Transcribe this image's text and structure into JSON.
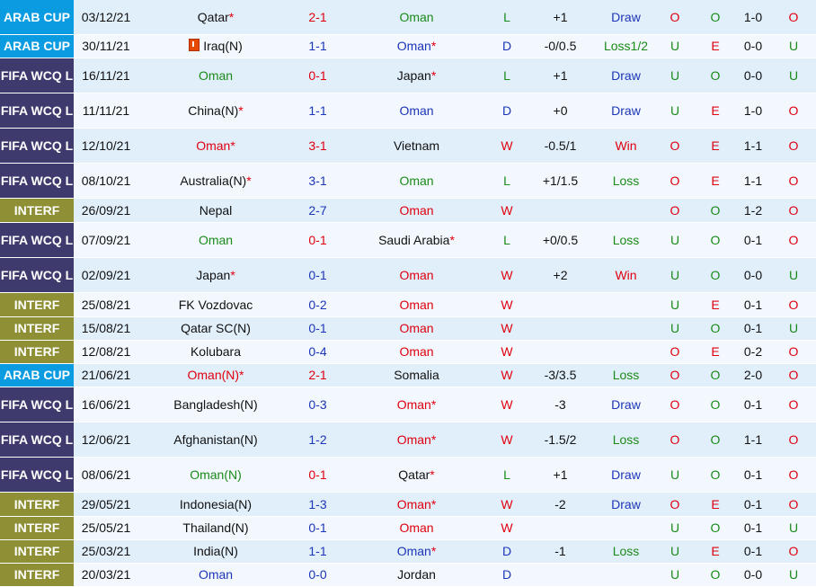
{
  "colors": {
    "arab_cup": "#0a9be0",
    "fifa_wcq": "#3f3a6e",
    "interf": "#8f9036",
    "red": "#e0000f",
    "green": "#1a8a1a",
    "blue": "#1d35b8"
  },
  "matches": [
    {
      "league": "ARAB CUP",
      "ltype": "arab",
      "date": "03/12/21",
      "home": "Qatar",
      "home_star": "*",
      "home_color": "dark",
      "score": "2-1",
      "score_color": "red",
      "away": "Oman",
      "away_star": "",
      "away_color": "green",
      "res": "L",
      "res_color": "green",
      "hcap": "+1",
      "hres": "Draw",
      "hres_color": "blue",
      "ou1": "O",
      "ou1_color": "red",
      "ou2": "O",
      "ou2_color": "green",
      "ht": "1-0",
      "last": "O",
      "last_color": "red",
      "h": 38
    },
    {
      "league": "ARAB CUP",
      "ltype": "arab",
      "date": "30/11/21",
      "home": "Iraq(N)",
      "home_star": "",
      "home_color": "dark",
      "home_flag": true,
      "score": "1-1",
      "score_color": "blue",
      "away": "Oman",
      "away_star": "*",
      "away_color": "blue",
      "res": "D",
      "res_color": "blue",
      "hcap": "-0/0.5",
      "hres": "Loss1/2",
      "hres_color": "green",
      "ou1": "U",
      "ou1_color": "green",
      "ou2": "E",
      "ou2_color": "red",
      "ht": "0-0",
      "last": "U",
      "last_color": "green",
      "h": 26
    },
    {
      "league": "FIFA WCQ L",
      "ltype": "fifa",
      "date": "16/11/21",
      "home": "Oman",
      "home_star": "",
      "home_color": "green",
      "score": "0-1",
      "score_color": "red",
      "away": "Japan",
      "away_star": "*",
      "away_color": "dark",
      "res": "L",
      "res_color": "green",
      "hcap": "+1",
      "hres": "Draw",
      "hres_color": "blue",
      "ou1": "U",
      "ou1_color": "green",
      "ou2": "O",
      "ou2_color": "green",
      "ht": "0-0",
      "last": "U",
      "last_color": "green",
      "h": 39
    },
    {
      "league": "FIFA WCQ L",
      "ltype": "fifa",
      "date": "11/11/21",
      "home": "China(N)",
      "home_star": "*",
      "home_color": "dark",
      "score": "1-1",
      "score_color": "blue",
      "away": "Oman",
      "away_star": "",
      "away_color": "blue",
      "res": "D",
      "res_color": "blue",
      "hcap": "+0",
      "hres": "Draw",
      "hres_color": "blue",
      "ou1": "U",
      "ou1_color": "green",
      "ou2": "E",
      "ou2_color": "red",
      "ht": "1-0",
      "last": "O",
      "last_color": "red",
      "h": 39
    },
    {
      "league": "FIFA WCQ L",
      "ltype": "fifa",
      "date": "12/10/21",
      "home": "Oman",
      "home_star": "*",
      "home_color": "red",
      "score": "3-1",
      "score_color": "red",
      "away": "Vietnam",
      "away_star": "",
      "away_color": "dark",
      "res": "W",
      "res_color": "red",
      "hcap": "-0.5/1",
      "hres": "Win",
      "hres_color": "red",
      "ou1": "O",
      "ou1_color": "red",
      "ou2": "E",
      "ou2_color": "red",
      "ht": "1-1",
      "last": "O",
      "last_color": "red",
      "h": 39
    },
    {
      "league": "FIFA WCQ L",
      "ltype": "fifa",
      "date": "08/10/21",
      "home": "Australia(N)",
      "home_star": "*",
      "home_color": "dark",
      "score": "3-1",
      "score_color": "blue",
      "away": "Oman",
      "away_star": "",
      "away_color": "green",
      "res": "L",
      "res_color": "green",
      "hcap": "+1/1.5",
      "hres": "Loss",
      "hres_color": "green",
      "ou1": "O",
      "ou1_color": "red",
      "ou2": "E",
      "ou2_color": "red",
      "ht": "1-1",
      "last": "O",
      "last_color": "red",
      "h": 39
    },
    {
      "league": "INTERF",
      "ltype": "interf",
      "date": "26/09/21",
      "home": "Nepal",
      "home_star": "",
      "home_color": "dark",
      "score": "2-7",
      "score_color": "blue",
      "away": "Oman",
      "away_star": "",
      "away_color": "red",
      "res": "W",
      "res_color": "red",
      "hcap": "",
      "hres": "",
      "hres_color": "dark",
      "ou1": "O",
      "ou1_color": "red",
      "ou2": "O",
      "ou2_color": "green",
      "ht": "1-2",
      "last": "O",
      "last_color": "red",
      "h": 27
    },
    {
      "league": "FIFA WCQ L",
      "ltype": "fifa",
      "date": "07/09/21",
      "home": "Oman",
      "home_star": "",
      "home_color": "green",
      "score": "0-1",
      "score_color": "red",
      "away": "Saudi Arabia",
      "away_star": "*",
      "away_color": "dark",
      "res": "L",
      "res_color": "green",
      "hcap": "+0/0.5",
      "hres": "Loss",
      "hres_color": "green",
      "ou1": "U",
      "ou1_color": "green",
      "ou2": "O",
      "ou2_color": "green",
      "ht": "0-1",
      "last": "O",
      "last_color": "red",
      "h": 39
    },
    {
      "league": "FIFA WCQ L",
      "ltype": "fifa",
      "date": "02/09/21",
      "home": "Japan",
      "home_star": "*",
      "home_color": "dark",
      "score": "0-1",
      "score_color": "blue",
      "away": "Oman",
      "away_star": "",
      "away_color": "red",
      "res": "W",
      "res_color": "red",
      "hcap": "+2",
      "hres": "Win",
      "hres_color": "red",
      "ou1": "U",
      "ou1_color": "green",
      "ou2": "O",
      "ou2_color": "green",
      "ht": "0-0",
      "last": "U",
      "last_color": "green",
      "h": 39
    },
    {
      "league": "INTERF",
      "ltype": "interf",
      "date": "25/08/21",
      "home": "FK Vozdovac",
      "home_star": "",
      "home_color": "dark",
      "score": "0-2",
      "score_color": "blue",
      "away": "Oman",
      "away_star": "",
      "away_color": "red",
      "res": "W",
      "res_color": "red",
      "hcap": "",
      "hres": "",
      "hres_color": "dark",
      "ou1": "U",
      "ou1_color": "green",
      "ou2": "E",
      "ou2_color": "red",
      "ht": "0-1",
      "last": "O",
      "last_color": "red",
      "h": 27
    },
    {
      "league": "INTERF",
      "ltype": "interf",
      "date": "15/08/21",
      "home": "Qatar SC(N)",
      "home_star": "",
      "home_color": "dark",
      "score": "0-1",
      "score_color": "blue",
      "away": "Oman",
      "away_star": "",
      "away_color": "red",
      "res": "W",
      "res_color": "red",
      "hcap": "",
      "hres": "",
      "hres_color": "dark",
      "ou1": "U",
      "ou1_color": "green",
      "ou2": "O",
      "ou2_color": "green",
      "ht": "0-1",
      "last": "U",
      "last_color": "green",
      "h": 26
    },
    {
      "league": "INTERF",
      "ltype": "interf",
      "date": "12/08/21",
      "home": "Kolubara",
      "home_star": "",
      "home_color": "dark",
      "score": "0-4",
      "score_color": "blue",
      "away": "Oman",
      "away_star": "",
      "away_color": "red",
      "res": "W",
      "res_color": "red",
      "hcap": "",
      "hres": "",
      "hres_color": "dark",
      "ou1": "O",
      "ou1_color": "red",
      "ou2": "E",
      "ou2_color": "red",
      "ht": "0-2",
      "last": "O",
      "last_color": "red",
      "h": 26
    },
    {
      "league": "ARAB CUP",
      "ltype": "arab",
      "date": "21/06/21",
      "home": "Oman(N)",
      "home_star": "*",
      "home_color": "red",
      "score": "2-1",
      "score_color": "red",
      "away": "Somalia",
      "away_star": "",
      "away_color": "dark",
      "res": "W",
      "res_color": "red",
      "hcap": "-3/3.5",
      "hres": "Loss",
      "hres_color": "green",
      "ou1": "O",
      "ou1_color": "red",
      "ou2": "O",
      "ou2_color": "green",
      "ht": "2-0",
      "last": "O",
      "last_color": "red",
      "h": 26
    },
    {
      "league": "FIFA WCQ L",
      "ltype": "fifa",
      "date": "16/06/21",
      "home": "Bangladesh(N)",
      "home_star": "",
      "home_color": "dark",
      "score": "0-3",
      "score_color": "blue",
      "away": "Oman",
      "away_star": "*",
      "away_color": "red",
      "res": "W",
      "res_color": "red",
      "hcap": "-3",
      "hres": "Draw",
      "hres_color": "blue",
      "ou1": "O",
      "ou1_color": "red",
      "ou2": "O",
      "ou2_color": "green",
      "ht": "0-1",
      "last": "O",
      "last_color": "red",
      "h": 39
    },
    {
      "league": "FIFA WCQ L",
      "ltype": "fifa",
      "date": "12/06/21",
      "home": "Afghanistan(N)",
      "home_star": "",
      "home_color": "dark",
      "score": "1-2",
      "score_color": "blue",
      "away": "Oman",
      "away_star": "*",
      "away_color": "red",
      "res": "W",
      "res_color": "red",
      "hcap": "-1.5/2",
      "hres": "Loss",
      "hres_color": "green",
      "ou1": "O",
      "ou1_color": "red",
      "ou2": "O",
      "ou2_color": "green",
      "ht": "1-1",
      "last": "O",
      "last_color": "red",
      "h": 39
    },
    {
      "league": "FIFA WCQ L",
      "ltype": "fifa",
      "date": "08/06/21",
      "home": "Oman(N)",
      "home_star": "",
      "home_color": "green",
      "score": "0-1",
      "score_color": "red",
      "away": "Qatar",
      "away_star": "*",
      "away_color": "dark",
      "res": "L",
      "res_color": "green",
      "hcap": "+1",
      "hres": "Draw",
      "hres_color": "blue",
      "ou1": "U",
      "ou1_color": "green",
      "ou2": "O",
      "ou2_color": "green",
      "ht": "0-1",
      "last": "O",
      "last_color": "red",
      "h": 39
    },
    {
      "league": "INTERF",
      "ltype": "interf",
      "date": "29/05/21",
      "home": "Indonesia(N)",
      "home_star": "",
      "home_color": "dark",
      "score": "1-3",
      "score_color": "blue",
      "away": "Oman",
      "away_star": "*",
      "away_color": "red",
      "res": "W",
      "res_color": "red",
      "hcap": "-2",
      "hres": "Draw",
      "hres_color": "blue",
      "ou1": "O",
      "ou1_color": "red",
      "ou2": "E",
      "ou2_color": "red",
      "ht": "0-1",
      "last": "O",
      "last_color": "red",
      "h": 27
    },
    {
      "league": "INTERF",
      "ltype": "interf",
      "date": "25/05/21",
      "home": "Thailand(N)",
      "home_star": "",
      "home_color": "dark",
      "score": "0-1",
      "score_color": "blue",
      "away": "Oman",
      "away_star": "",
      "away_color": "red",
      "res": "W",
      "res_color": "red",
      "hcap": "",
      "hres": "",
      "hres_color": "dark",
      "ou1": "U",
      "ou1_color": "green",
      "ou2": "O",
      "ou2_color": "green",
      "ht": "0-1",
      "last": "U",
      "last_color": "green",
      "h": 26
    },
    {
      "league": "INTERF",
      "ltype": "interf",
      "date": "25/03/21",
      "home": "India(N)",
      "home_star": "",
      "home_color": "dark",
      "score": "1-1",
      "score_color": "blue",
      "away": "Oman",
      "away_star": "*",
      "away_color": "blue",
      "res": "D",
      "res_color": "blue",
      "hcap": "-1",
      "hres": "Loss",
      "hres_color": "green",
      "ou1": "U",
      "ou1_color": "green",
      "ou2": "E",
      "ou2_color": "red",
      "ht": "0-1",
      "last": "O",
      "last_color": "red",
      "h": 26
    },
    {
      "league": "INTERF",
      "ltype": "interf",
      "date": "20/03/21",
      "home": "Oman",
      "home_star": "",
      "home_color": "blue",
      "score": "0-0",
      "score_color": "blue",
      "away": "Jordan",
      "away_star": "",
      "away_color": "dark",
      "res": "D",
      "res_color": "blue",
      "hcap": "",
      "hres": "",
      "hres_color": "dark",
      "ou1": "U",
      "ou1_color": "green",
      "ou2": "O",
      "ou2_color": "green",
      "ht": "0-0",
      "last": "U",
      "last_color": "green",
      "h": 26
    }
  ]
}
